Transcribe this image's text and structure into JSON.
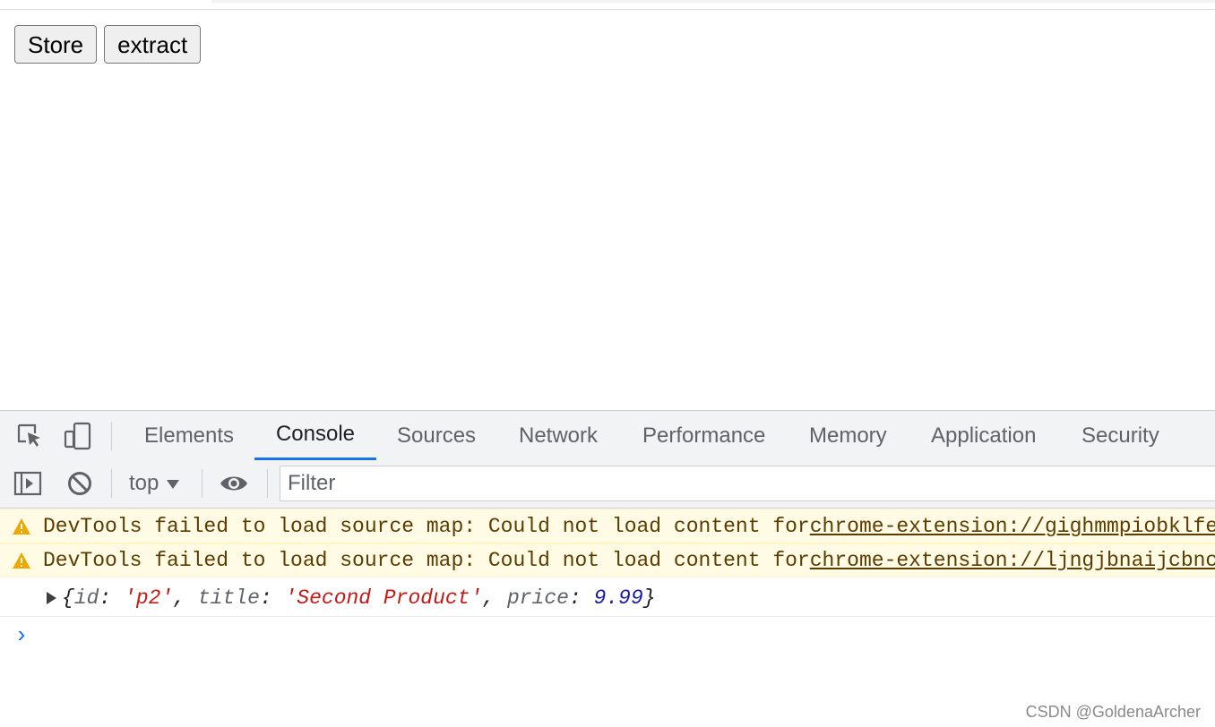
{
  "page": {
    "buttons": {
      "store": "Store",
      "extract": "extract"
    }
  },
  "devtools": {
    "tabs": [
      {
        "label": "Elements"
      },
      {
        "label": "Console",
        "active": true
      },
      {
        "label": "Sources"
      },
      {
        "label": "Network"
      },
      {
        "label": "Performance"
      },
      {
        "label": "Memory"
      },
      {
        "label": "Application"
      },
      {
        "label": "Security"
      }
    ],
    "toolbar": {
      "context": "top",
      "filter_placeholder": "Filter"
    },
    "console": {
      "warnings": [
        {
          "text": "DevTools failed to load source map: Could not load content for ",
          "link": "chrome-extension://gighmmpiobklfepjocnamgkkbiglidom"
        },
        {
          "text": "DevTools failed to load source map: Could not load content for ",
          "link": "chrome-extension://ljngjbnaijcbncmcnjfhigebomdlkcjo"
        }
      ],
      "object": {
        "open": "{",
        "id_key": "id",
        "id_val": "'p2'",
        "title_key": "title",
        "title_val": "'Second Product'",
        "price_key": "price",
        "price_val": "9.99",
        "close": "}"
      },
      "prompt": "›"
    },
    "colors": {
      "accent": "#1a73e8",
      "warning_bg": "#fffbe5",
      "warning_text": "#5c3c00",
      "string": "#c41a16",
      "number": "#1a1aa6"
    }
  },
  "watermark": "CSDN @GoldenaArcher"
}
